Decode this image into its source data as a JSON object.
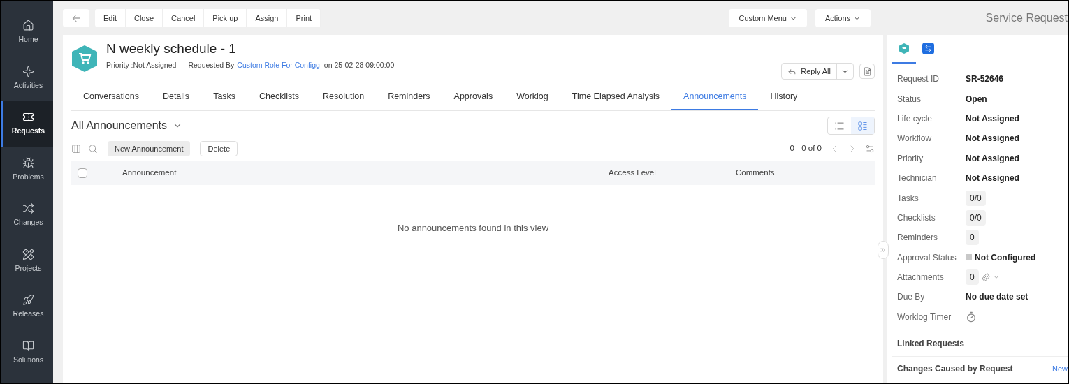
{
  "sidebar": {
    "items": [
      {
        "label": "Home",
        "selected": false
      },
      {
        "label": "Activities",
        "selected": false
      },
      {
        "label": "Requests",
        "selected": true
      },
      {
        "label": "Problems",
        "selected": false
      },
      {
        "label": "Changes",
        "selected": false
      },
      {
        "label": "Projects",
        "selected": false
      },
      {
        "label": "Releases",
        "selected": false
      },
      {
        "label": "Solutions",
        "selected": false
      }
    ]
  },
  "toolbar": {
    "buttons": [
      "Edit",
      "Close",
      "Cancel",
      "Pick up",
      "Assign",
      "Print"
    ],
    "menus": [
      "Custom Menu",
      "Actions"
    ]
  },
  "request": {
    "title": "N weekly schedule - 1",
    "priority": "Priority :Not Assigned",
    "requested_by": "Requested By",
    "requester": "Custom Role For Configg",
    "date": "on 25-02-28 09:00:00",
    "reply_button": "Reply All"
  },
  "tabs": [
    {
      "label": "Conversations",
      "selected": false
    },
    {
      "label": "Details",
      "selected": false
    },
    {
      "label": "Tasks",
      "selected": false
    },
    {
      "label": "Checklists",
      "selected": false
    },
    {
      "label": "Resolution",
      "selected": false
    },
    {
      "label": "Reminders",
      "selected": false
    },
    {
      "label": "Approvals",
      "selected": false
    },
    {
      "label": "Worklog",
      "selected": false
    },
    {
      "label": "Time Elapsed Analysis",
      "selected": false
    },
    {
      "label": "Announcements",
      "selected": true
    },
    {
      "label": "History",
      "selected": false
    }
  ],
  "view": {
    "title": "All Announcements",
    "view_modes": [
      {
        "kind": "list",
        "selected": false
      },
      {
        "kind": "detail",
        "selected": true
      }
    ],
    "buttons": [
      "New Announcement",
      "Delete"
    ],
    "pagination": "0 - 0 of 0"
  },
  "table": {
    "select_all_checked": false,
    "columns": [
      "Announcement",
      "Access Level",
      "Comments"
    ],
    "empty_message": "No announcements found in this view"
  },
  "details_panel": {
    "title": "Service Request",
    "tabs": [
      {
        "kind": "request",
        "selected": true
      },
      {
        "kind": "remote",
        "selected": false
      }
    ],
    "fields": [
      {
        "label": "Request ID",
        "value": "SR-52646",
        "kind": "text"
      },
      {
        "label": "Status",
        "value": "Open",
        "kind": "text"
      },
      {
        "label": "Life cycle",
        "value": "Not Assigned",
        "kind": "text"
      },
      {
        "label": "Workflow",
        "value": "Not Assigned",
        "kind": "text"
      },
      {
        "label": "Priority",
        "value": "Not Assigned",
        "kind": "text"
      },
      {
        "label": "Technician",
        "value": "Not Assigned",
        "kind": "text"
      },
      {
        "label": "Tasks",
        "value": "0/0",
        "kind": "badge"
      },
      {
        "label": "Checklists",
        "value": "0/0",
        "kind": "badge"
      },
      {
        "label": "Reminders",
        "value": "0",
        "kind": "badge"
      },
      {
        "label": "Approval Status",
        "value": "Not Configured",
        "kind": "status",
        "color": "#c8c8c8"
      },
      {
        "label": "Attachments",
        "value": "0",
        "kind": "attachment"
      },
      {
        "label": "Due By",
        "value": "No due date set",
        "kind": "text"
      },
      {
        "label": "Worklog Timer",
        "kind": "timer"
      }
    ],
    "sections": [
      "Linked Requests",
      "Changes Caused by Request"
    ],
    "new_link": "New"
  }
}
